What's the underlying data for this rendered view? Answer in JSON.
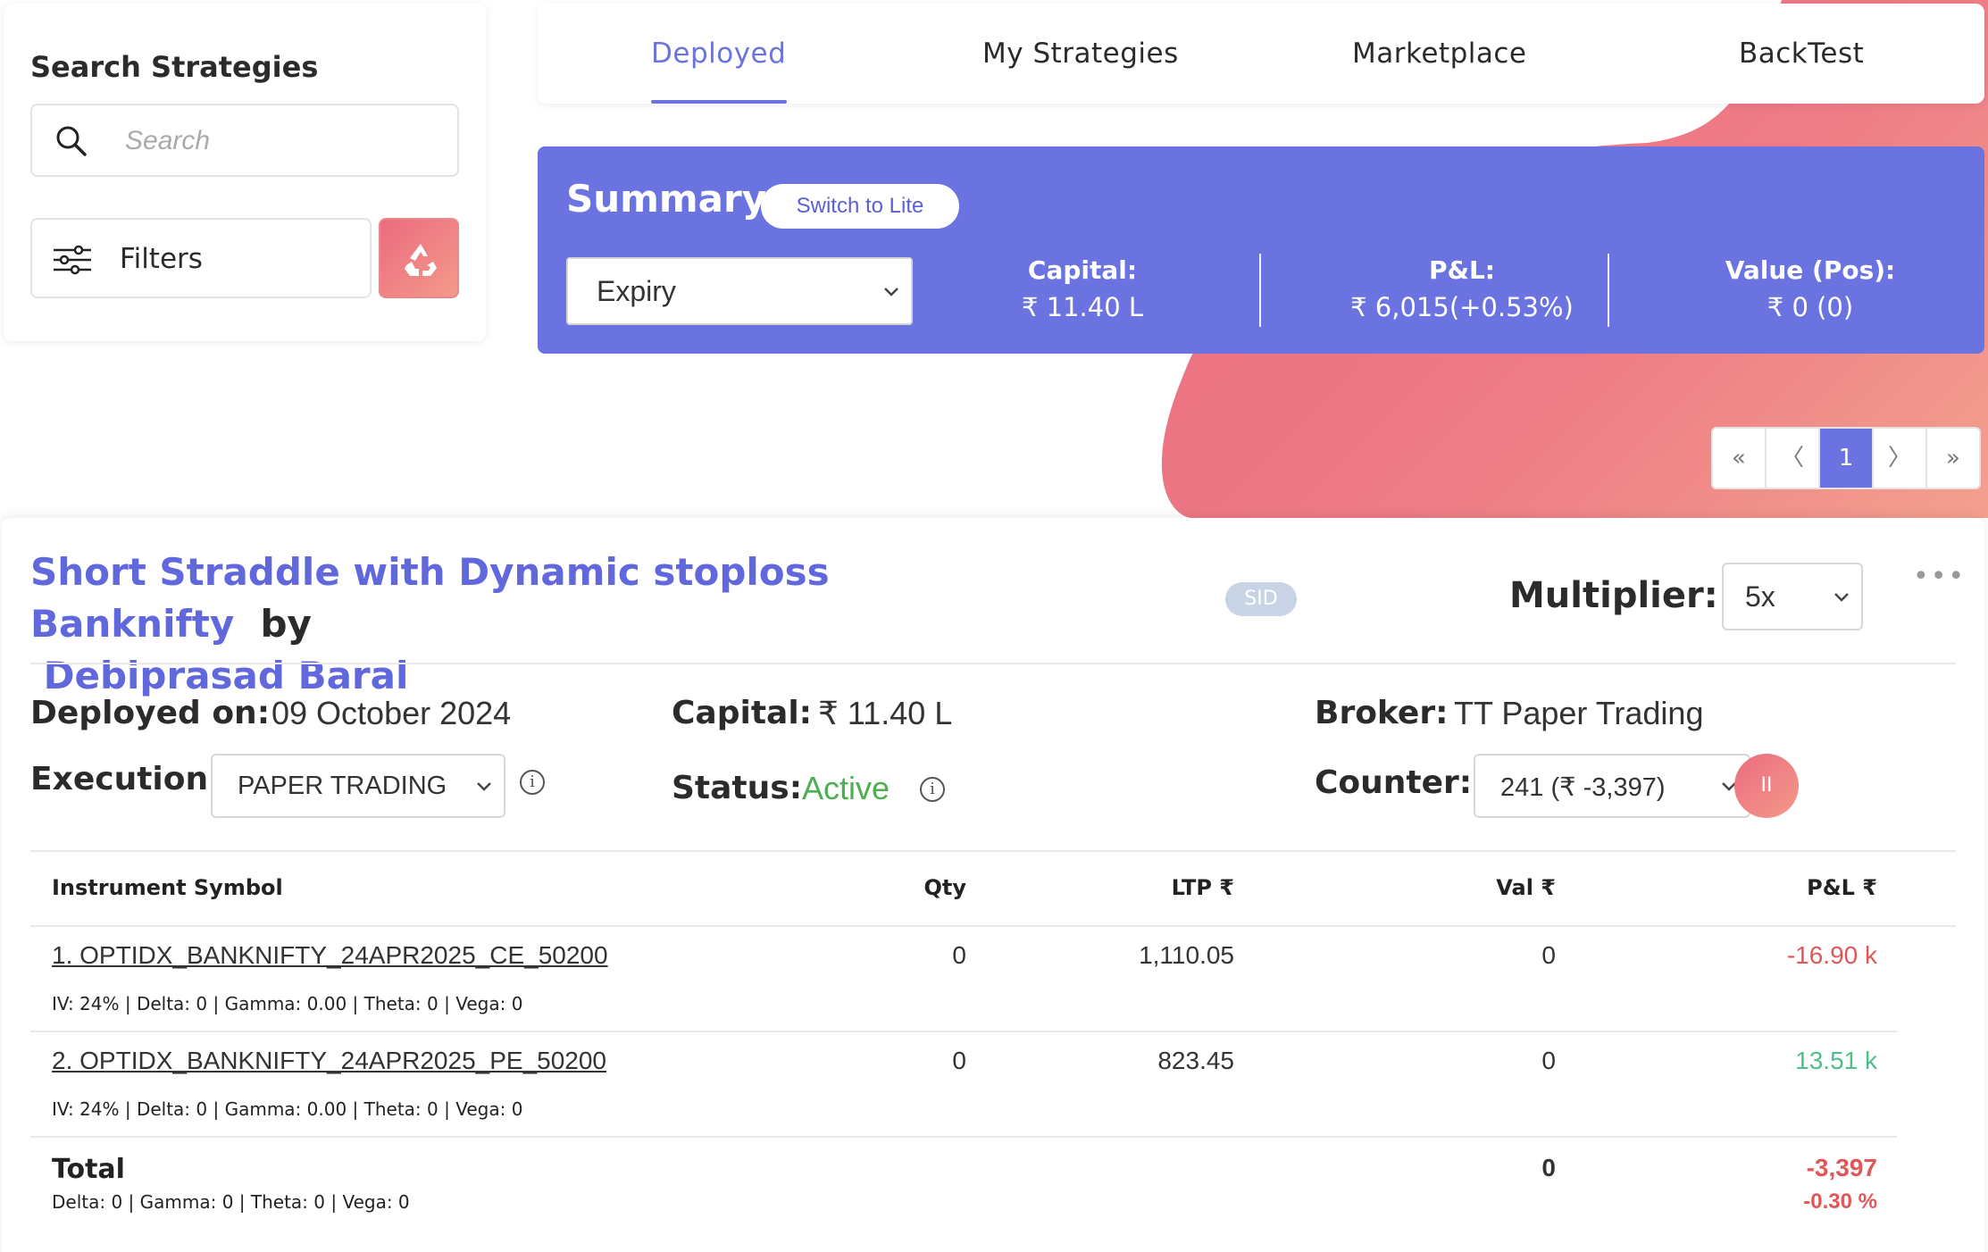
{
  "search": {
    "title": "Search Strategies",
    "placeholder": "Search",
    "filters_label": "Filters"
  },
  "tabs": [
    {
      "label": "Deployed",
      "active": true
    },
    {
      "label": "My Strategies",
      "active": false
    },
    {
      "label": "Marketplace",
      "active": false
    },
    {
      "label": "BackTest",
      "active": false
    }
  ],
  "summary": {
    "title": "Summary",
    "switch_label": "Switch to Lite",
    "expiry_selected": "Expiry",
    "capital_label": "Capital:",
    "capital_value": "₹ 11.40 L",
    "pnl_label": "P&L:",
    "pnl_value": "₹ 6,015(+0.53%)",
    "value_label": "Value (Pos):",
    "value_value": "₹ 0 (0)"
  },
  "pagination": {
    "first": "«",
    "prev": "〈",
    "current": "1",
    "next": "〉",
    "last": "»"
  },
  "strategy": {
    "name_line1": "Short Straddle with Dynamic stoploss Banknifty",
    "by": "by",
    "author": "Debiprasad Baral",
    "badge": "SID",
    "multiplier_label": "Multiplier:",
    "multiplier_value": "5x",
    "more": "•••",
    "deployed_label": "Deployed on:",
    "deployed_value": "09 October 2024",
    "capital_label": "Capital:",
    "capital_value": "₹ 11.40 L",
    "broker_label": "Broker:",
    "broker_value": "TT Paper Trading",
    "execution_label": "Execution:",
    "execution_value": "PAPER TRADING",
    "status_label": "Status:",
    "status_value": "Active",
    "counter_label": "Counter:",
    "counter_value": "241 (₹ -3,397)",
    "pause_icon": "II"
  },
  "table": {
    "headers": {
      "symbol": "Instrument Symbol",
      "qty": "Qty",
      "ltp": "LTP ₹",
      "val": "Val ₹",
      "pnl": "P&L ₹"
    },
    "rows": [
      {
        "symbol": "1. OPTIDX_BANKNIFTY_24APR2025_CE_50200",
        "greeks": "IV: 24% | Delta: 0 | Gamma: 0.00 | Theta: 0 | Vega: 0",
        "qty": "0",
        "ltp": "1,110.05",
        "val": "0",
        "pnl": "-16.90 k"
      },
      {
        "symbol": "2. OPTIDX_BANKNIFTY_24APR2025_PE_50200",
        "greeks": "IV: 24% | Delta: 0 | Gamma: 0.00 | Theta: 0 | Vega: 0",
        "qty": "0",
        "ltp": "823.45",
        "val": "0",
        "pnl": "13.51 k"
      }
    ],
    "total": {
      "label": "Total",
      "greeks": "Delta: 0 | Gamma: 0  | Theta: 0 | Vega: 0",
      "val": "0",
      "pnl": "-3,397",
      "pnl_pct": "-0.30 %"
    }
  },
  "colors": {
    "accent": "#6a73e0",
    "loss": "#e05757",
    "profit": "#4fbf8a",
    "status_active": "#4caf50"
  }
}
